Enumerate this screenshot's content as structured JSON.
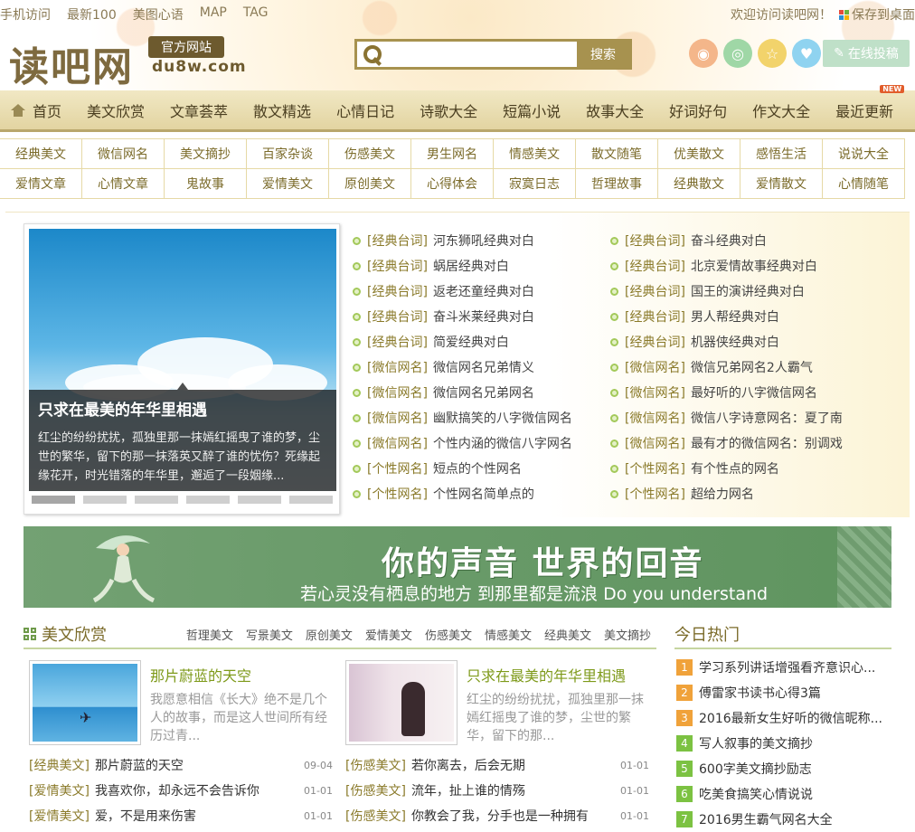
{
  "header": {
    "top_links": [
      "手机访问",
      "最新100",
      "美图心语",
      "MAP",
      "TAG"
    ],
    "welcome": "欢迎访问读吧网！",
    "save_desktop": "保存到桌面",
    "logo_text": "读吧网",
    "official_badge": "官方网站",
    "domain": "du8w.com",
    "search_placeholder": "",
    "search_button": "搜索",
    "post_button": "在线投稿"
  },
  "nav": {
    "items": [
      "首页",
      "美文欣赏",
      "文章荟萃",
      "散文精选",
      "心情日记",
      "诗歌大全",
      "短篇小说",
      "故事大全",
      "好词好句",
      "作文大全",
      "最近更新"
    ],
    "new_tag": "NEW"
  },
  "categories": {
    "row1": [
      "经典美文",
      "微信网名",
      "美文摘抄",
      "百家杂谈",
      "伤感美文",
      "男生网名",
      "情感美文",
      "散文随笔",
      "优美散文",
      "感悟生活",
      "说说大全"
    ],
    "row2": [
      "爱情文章",
      "心情文章",
      "鬼故事",
      "爱情美文",
      "原创美文",
      "心得体会",
      "寂寞日志",
      "哲理故事",
      "经典散文",
      "爱情散文",
      "心情随笔"
    ]
  },
  "slider": {
    "title": "只求在最美的年华里相遇",
    "desc": "红尘的纷纷扰扰，孤独里那一抹嫣红摇曳了谁的梦，尘世的繁华，留下的那一抹落英又醉了谁的忧伤？死缘起缘花开，时光错落的年华里，邂逅了一段姻缘..."
  },
  "news_left": [
    {
      "tag": "[经典台词]",
      "title": "河东狮吼经典对白"
    },
    {
      "tag": "[经典台词]",
      "title": "蜗居经典对白"
    },
    {
      "tag": "[经典台词]",
      "title": "返老还童经典对白"
    },
    {
      "tag": "[经典台词]",
      "title": "奋斗米莱经典对白"
    },
    {
      "tag": "[经典台词]",
      "title": "简爱经典对白"
    },
    {
      "tag": "[微信网名]",
      "title": "微信网名兄弟情义"
    },
    {
      "tag": "[微信网名]",
      "title": "微信网名兄弟网名"
    },
    {
      "tag": "[微信网名]",
      "title": "幽默搞笑的八字微信网名"
    },
    {
      "tag": "[微信网名]",
      "title": "个性内涵的微信八字网名"
    },
    {
      "tag": "[个性网名]",
      "title": "短点的个性网名"
    },
    {
      "tag": "[个性网名]",
      "title": "个性网名简单点的"
    }
  ],
  "news_right": [
    {
      "tag": "[经典台词]",
      "title": "奋斗经典对白"
    },
    {
      "tag": "[经典台词]",
      "title": "北京爱情故事经典对白"
    },
    {
      "tag": "[经典台词]",
      "title": "国王的演讲经典对白"
    },
    {
      "tag": "[经典台词]",
      "title": "男人帮经典对白"
    },
    {
      "tag": "[经典台词]",
      "title": "机器侠经典对白"
    },
    {
      "tag": "[微信网名]",
      "title": "微信兄弟网名2人霸气"
    },
    {
      "tag": "[微信网名]",
      "title": "最好听的八字微信网名"
    },
    {
      "tag": "[微信网名]",
      "title": "微信八字诗意网名：夏了南"
    },
    {
      "tag": "[微信网名]",
      "title": "最有才的微信网名：别调戏"
    },
    {
      "tag": "[个性网名]",
      "title": "有个性点的网名"
    },
    {
      "tag": "[个性网名]",
      "title": "超给力网名"
    }
  ],
  "banner": {
    "headline": "你的声音 世界的回音",
    "sub": "若心灵没有栖息的地方 到那里都是流浪 Do you understand"
  },
  "section": {
    "title": "美文欣赏",
    "tabs": [
      "哲理美文",
      "写景美文",
      "原创美文",
      "爱情美文",
      "伤感美文",
      "情感美文",
      "经典美文",
      "美文摘抄"
    ]
  },
  "featured": [
    {
      "title": "那片蔚蓝的天空",
      "desc": "我愿意相信《长大》绝不是几个人的故事，而是这人世间所有经历过青..."
    },
    {
      "title": "只求在最美的年华里相遇",
      "desc": "红尘的纷纷扰扰，孤独里那一抹嫣红摇曳了谁的梦，尘世的繁华，留下的那..."
    }
  ],
  "articles_left": [
    {
      "tag": "[经典美文]",
      "title": "那片蔚蓝的天空",
      "date": "09-04"
    },
    {
      "tag": "[爱情美文]",
      "title": "我喜欢你，却永远不会告诉你",
      "date": "01-01"
    },
    {
      "tag": "[爱情美文]",
      "title": "爱，不是用来伤害",
      "date": "01-01"
    }
  ],
  "articles_right": [
    {
      "tag": "[伤感美文]",
      "title": "若你离去，后会无期",
      "date": "01-01"
    },
    {
      "tag": "[伤感美文]",
      "title": "流年，扯上谁的情殇",
      "date": "01-01"
    },
    {
      "tag": "[伤感美文]",
      "title": "你教会了我，分手也是一种拥有",
      "date": "01-01"
    }
  ],
  "hot": {
    "title": "今日热门",
    "items": [
      {
        "n": "1",
        "title": "学习系列讲话增强看齐意识心..."
      },
      {
        "n": "2",
        "title": "傅雷家书读书心得3篇"
      },
      {
        "n": "3",
        "title": "2016最新女生好听的微信昵称..."
      },
      {
        "n": "4",
        "title": "写人叙事的美文摘抄"
      },
      {
        "n": "5",
        "title": "600字美文摘抄励志"
      },
      {
        "n": "6",
        "title": "吃美食搞笑心情说说"
      },
      {
        "n": "7",
        "title": "2016男生霸气网名大全"
      }
    ]
  },
  "colors": {
    "accent": "#a7924f",
    "green": "#7e9a1a",
    "hot_orange": "#f0a23a",
    "hot_green": "#7cc242"
  }
}
